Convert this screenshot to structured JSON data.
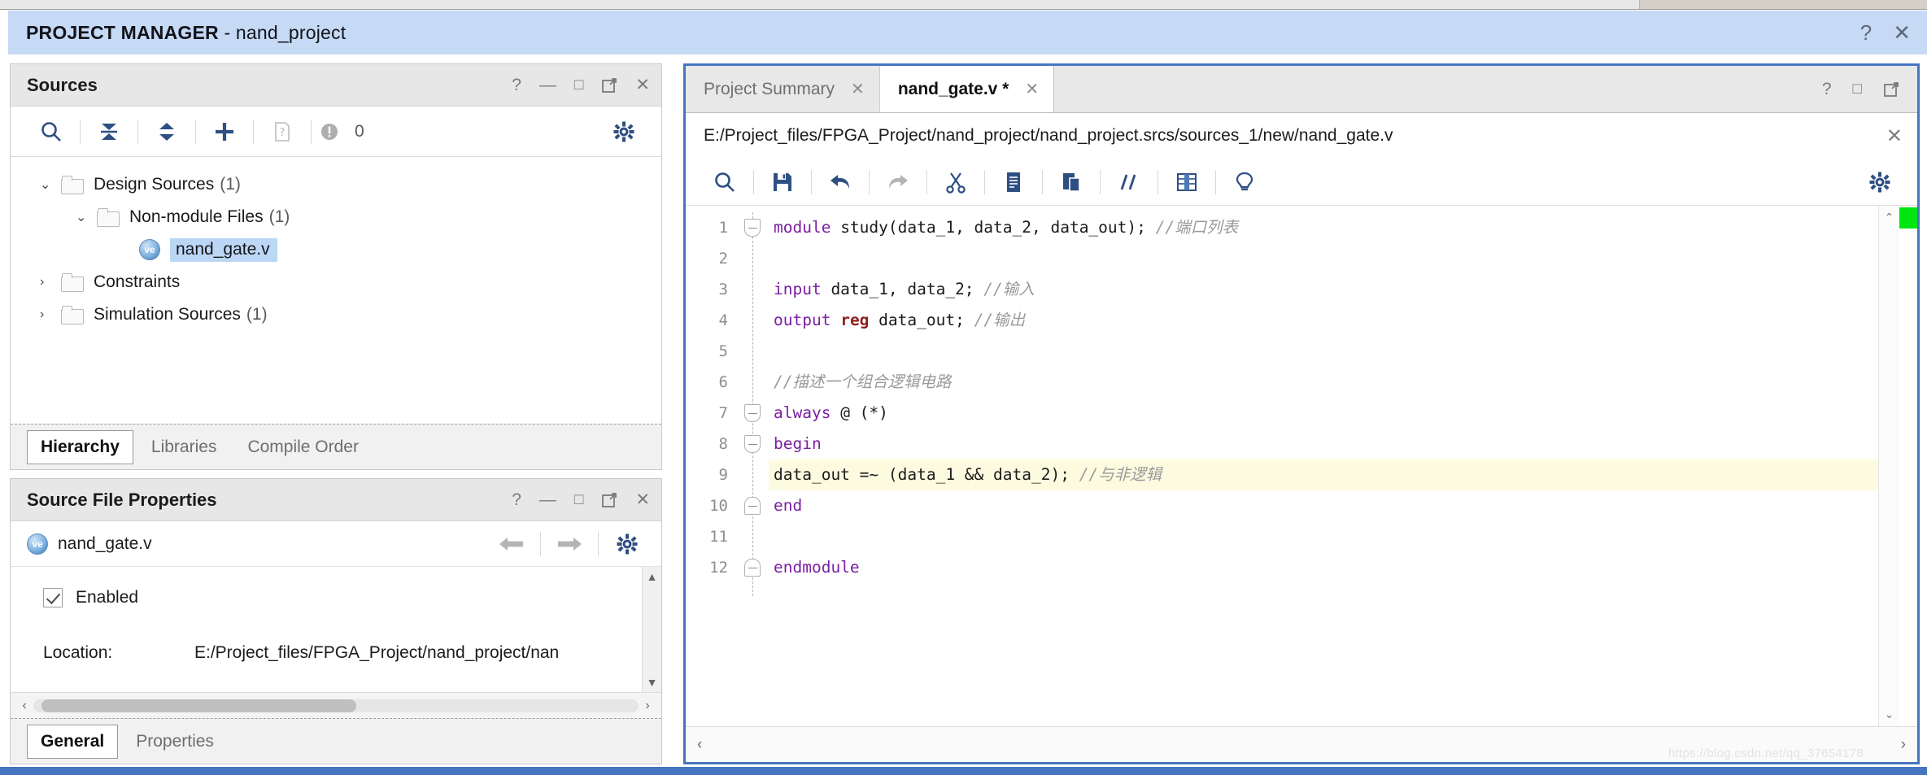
{
  "window": {
    "title_bold": "PROJECT MANAGER",
    "title_sep": " - ",
    "title_project": "nand_project",
    "help_icon": "?",
    "close_icon": "✕"
  },
  "sources_panel": {
    "title": "Sources",
    "header_icons": {
      "help": "?",
      "minimize": "—",
      "maximize": "□",
      "float": "↗",
      "close": "✕"
    },
    "toolbar": {
      "search": "search-icon",
      "collapse_all": "collapse-all-icon",
      "expand_collapse": "expand-collapse-icon",
      "add_sources": "plus-icon",
      "report": "report-file-icon",
      "messages_icon": "circle-icon",
      "messages_count": "0",
      "settings": "gear-icon"
    },
    "tree": [
      {
        "label": "Design Sources",
        "count": "(1)",
        "level": 1,
        "twisty": "⌄",
        "icon": "folder",
        "selected": false
      },
      {
        "label": "Non-module Files",
        "count": "(1)",
        "level": 2,
        "twisty": "⌄",
        "icon": "folder",
        "selected": false
      },
      {
        "label": "nand_gate.v",
        "count": "",
        "level": 3,
        "twisty": "",
        "icon": "verilog-file",
        "selected": true
      },
      {
        "label": "Constraints",
        "count": "",
        "level": 1,
        "twisty": "›",
        "icon": "folder",
        "selected": false
      },
      {
        "label": "Simulation Sources",
        "count": "(1)",
        "level": 1,
        "twisty": "›",
        "icon": "folder",
        "selected": false
      }
    ],
    "tabs": [
      {
        "label": "Hierarchy",
        "active": true
      },
      {
        "label": "Libraries",
        "active": false
      },
      {
        "label": "Compile Order",
        "active": false
      }
    ]
  },
  "properties_panel": {
    "title": "Source File Properties",
    "header_icons": {
      "help": "?",
      "minimize": "—",
      "maximize": "□",
      "float": "↗",
      "close": "✕"
    },
    "file_name": "nand_gate.v",
    "nav": {
      "back": "←",
      "forward": "→",
      "settings": "gear-icon"
    },
    "enabled_label": "Enabled",
    "enabled_checked": true,
    "location_key": "Location:",
    "location_value": "E:/Project_files/FPGA_Project/nand_project/nan",
    "tabs": [
      {
        "label": "General",
        "active": true
      },
      {
        "label": "Properties",
        "active": false
      }
    ]
  },
  "editor": {
    "tabs": [
      {
        "label": "Project Summary",
        "active": false,
        "close": "✕"
      },
      {
        "label": "nand_gate.v *",
        "active": true,
        "close": "✕"
      }
    ],
    "header_icons": {
      "help": "?",
      "maximize": "□",
      "float": "↗"
    },
    "file_path": "E:/Project_files/FPGA_Project/nand_project/nand_project.srcs/sources_1/new/nand_gate.v",
    "path_close": "✕",
    "toolbar": [
      "search-icon",
      "save-icon",
      "undo-icon",
      "redo-icon",
      "cut-icon",
      "copy-icon",
      "paste-icon",
      "comment-icon",
      "indent-icon",
      "bulb-icon"
    ],
    "settings_icon": "gear-icon",
    "scroll": {
      "up": "⌃",
      "down": "⌄",
      "left": "‹",
      "right": "›"
    },
    "watermark": "https://blog.csdn.net/qq_37654178",
    "marker_color": "#00e510",
    "code_lines": [
      {
        "n": "1",
        "fold": "top",
        "highlight": false,
        "tokens": [
          {
            "t": "module",
            "c": "kw"
          },
          {
            "t": " study(data_1, data_2, data_out);",
            "c": ""
          },
          {
            "t": " //端口列表",
            "c": "cmt"
          }
        ]
      },
      {
        "n": "2",
        "fold": "",
        "highlight": false,
        "tokens": []
      },
      {
        "n": "3",
        "fold": "",
        "highlight": false,
        "tokens": [
          {
            "t": "input",
            "c": "kw"
          },
          {
            "t": " data_1, data_2;",
            "c": ""
          },
          {
            "t": " //输入",
            "c": "cmt"
          }
        ]
      },
      {
        "n": "4",
        "fold": "",
        "highlight": false,
        "tokens": [
          {
            "t": "output",
            "c": "kw"
          },
          {
            "t": " ",
            "c": ""
          },
          {
            "t": "reg",
            "c": "kw2"
          },
          {
            "t": " data_out;",
            "c": ""
          },
          {
            "t": " //输出",
            "c": "cmt"
          }
        ]
      },
      {
        "n": "5",
        "fold": "",
        "highlight": false,
        "tokens": []
      },
      {
        "n": "6",
        "fold": "",
        "highlight": false,
        "tokens": [
          {
            "t": "//描述一个组合逻辑电路",
            "c": "cmt"
          }
        ]
      },
      {
        "n": "7",
        "fold": "top",
        "highlight": false,
        "tokens": [
          {
            "t": "always",
            "c": "kw"
          },
          {
            "t": " @ (*)",
            "c": ""
          }
        ]
      },
      {
        "n": "8",
        "fold": "top",
        "highlight": false,
        "tokens": [
          {
            "t": "begin",
            "c": "kw"
          }
        ]
      },
      {
        "n": "9",
        "fold": "",
        "highlight": true,
        "tokens": [
          {
            "t": "data_out =~ (data_1 && data_2);",
            "c": ""
          },
          {
            "t": " //与非逻辑",
            "c": "cmt"
          }
        ]
      },
      {
        "n": "10",
        "fold": "end",
        "highlight": false,
        "tokens": [
          {
            "t": "end",
            "c": "kw"
          }
        ]
      },
      {
        "n": "11",
        "fold": "",
        "highlight": false,
        "tokens": []
      },
      {
        "n": "12",
        "fold": "end",
        "highlight": false,
        "tokens": [
          {
            "t": "endmodule",
            "c": "kw"
          }
        ]
      }
    ]
  },
  "colors": {
    "title_bar": "#c6d9f5",
    "editor_border": "#4675c0",
    "selection": "#bcd7f5",
    "line_highlight": "#fcfbe0",
    "keyword": "#7a1fa2",
    "reg_keyword": "#8f1f1f",
    "comment": "#9a9a9a"
  }
}
